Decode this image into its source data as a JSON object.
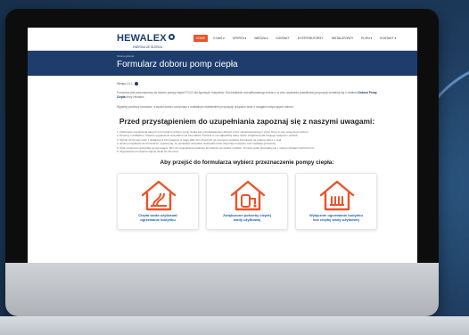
{
  "site": {
    "logo_text": "HEWALEX",
    "logo_tagline": "ENERGIA ZE SŁOŃCA",
    "nav": [
      {
        "label": "HOME",
        "active": true
      },
      {
        "label": "O NAS ▾",
        "active": false
      },
      {
        "label": "OFERTA ▾",
        "active": false
      },
      {
        "label": "WIEDZA ▾",
        "active": false
      },
      {
        "label": "KONTAKT",
        "active": false
      },
      {
        "label": "DYSTRYBUTORZY",
        "active": false
      },
      {
        "label": "INSTALATORZY",
        "active": false
      },
      {
        "label": "PL/EN ▾",
        "active": false
      },
      {
        "label": "KONTAKT ▾",
        "active": false
      }
    ]
  },
  "banner": {
    "breadcrumb": "Strona główna",
    "title": "Formularz doboru pomp ciepła"
  },
  "content": {
    "meta": "Wersja 1.0.1",
    "para1": "Formularz jest przeznaczony do doboru pompy ciepła PCCO dla typowych budynków. Dla dokładnie zweryfikowanego doboru i w celu uzyskania prawidłowej propozycji kontaktuj się z działem",
    "para1_bold": "Doboru Pomp Ciepła",
    "para1_tail": "firmy Hewalex.",
    "para2": "Wypełnij poniższy formularz, a wyniki doboru otrzymasz z dokładnym określeniem propozycji urządzeń wraz z uwagami dotyczącymi doboru.",
    "heading": "Przed przystąpieniem do uzupełniania zapoznaj się z naszymi uwagami:",
    "notes": [
      "1. Dokonanie wypełnienia danych w formularzu doboru pomp ciepła jest przedstawieniem danych przez zainteresowanego i przez firmę w celu wstępnego doboru.",
      "2. Prosimy o dokładne i rzetelne wypełnienie wszystkich pól formularza. Pozwoli to na najbardziej trafny dobór urządzenia dla Twojego budynku i potrzeb.",
      "3. Wyniki otrzymasz wraz z dokładnymi informacjami w ciągu kilku dni roboczych od momentu wysłania formularza na podany adres e-mail.",
      "4. Zanim przejdziesz do formularza, upewnij się, że posiadasz wszystkie niezbędne dane dotyczące budynku oraz instalacji grzewczej.",
      "5. Pola oznaczone gwiazdką są wymagane. Bez ich uzupełnienia wysłanie formularza nie będzie możliwe. W razie pytań skontaktuj się z naszym działem technicznym.",
      "6. Wypełnienie formularza zajmie około 10-15 minut."
    ],
    "choose_heading": "Aby przejść do formularza wybierz przeznaczenie pompy ciepła:",
    "cards": [
      {
        "label_line1": "Ciepła woda użytkowa/",
        "label_line2": "ogrzewanie budynku",
        "icon": "house-heating-icon"
      },
      {
        "label_line1": "Zwiększone potrzeby ciepłej",
        "label_line2": "wody użytkowej",
        "icon": "house-hot-water-icon"
      },
      {
        "label_line1": "Wyłącznie ogrzewanie budynku",
        "label_line2": "bez ciepłej wody użytkowej",
        "icon": "house-radiator-icon"
      }
    ]
  },
  "colors": {
    "accent": "#e8552a",
    "brand": "#1f3d6c",
    "card_label": "#1f5ea8"
  }
}
